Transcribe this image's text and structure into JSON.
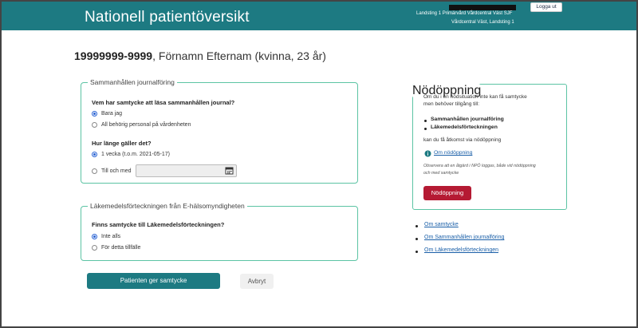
{
  "header": {
    "title": "Nationell patientöversikt",
    "unit_line1": "Landsting 1 Primärvård Vårdcentral Väst SJF",
    "unit_line2": "Vårdcentral Väst, Landsting 1",
    "logout_label": "Logga ut",
    "color": "#1d7a82"
  },
  "patient": {
    "id": "19999999-9999",
    "details": ", Förnamn Efternam (kvinna, 23 år)"
  },
  "consent": {
    "legend": "Sammanhållen journalföring",
    "question1": "Vem har samtycke att läsa sammanhållen journal?",
    "who_options": [
      {
        "label": "Bara jag",
        "selected": true
      },
      {
        "label": "All behörig personal på vårdenheten",
        "selected": false
      }
    ],
    "question2": "Hur länge gäller det?",
    "duration_options": [
      {
        "label": "1 vecka (t.o.m. 2021-05-17)",
        "selected": true
      },
      {
        "label": "Till och med",
        "selected": false
      }
    ],
    "date_value": ""
  },
  "medication": {
    "legend": "Läkemedelsförteckningen från E-hälsomyndigheten",
    "question": "Finns samtycke till Läkemedelsförteckningen?",
    "options": [
      {
        "label": "Inte alls",
        "selected": true
      },
      {
        "label": "För detta tillfälle",
        "selected": false
      }
    ]
  },
  "emergency": {
    "legend": "Nödöppning",
    "intro_line1": "Om du i en nödsituation inte kan få samtycke",
    "intro_line2": "men behöver tillgång till:",
    "items": [
      "Sammanhållen journalföring",
      "Läkemedelsförteckningen"
    ],
    "access_text": "kan du få åtkomst via nödöppning",
    "info_link": "Om nödöppning",
    "note_line1": "Observera att en åtgärd i NPÖ loggas, både vid nödöppning",
    "note_line2": "och med samtycke",
    "button_label": "Nödöppning",
    "button_color": "#b51a33"
  },
  "links": [
    "Om samtycke",
    "Om Sammanhållen journalföring",
    "Om Läkemedelsförteckningen"
  ],
  "actions": {
    "primary_label": "Patienten ger samtycke",
    "secondary_label": "Avbryt"
  }
}
